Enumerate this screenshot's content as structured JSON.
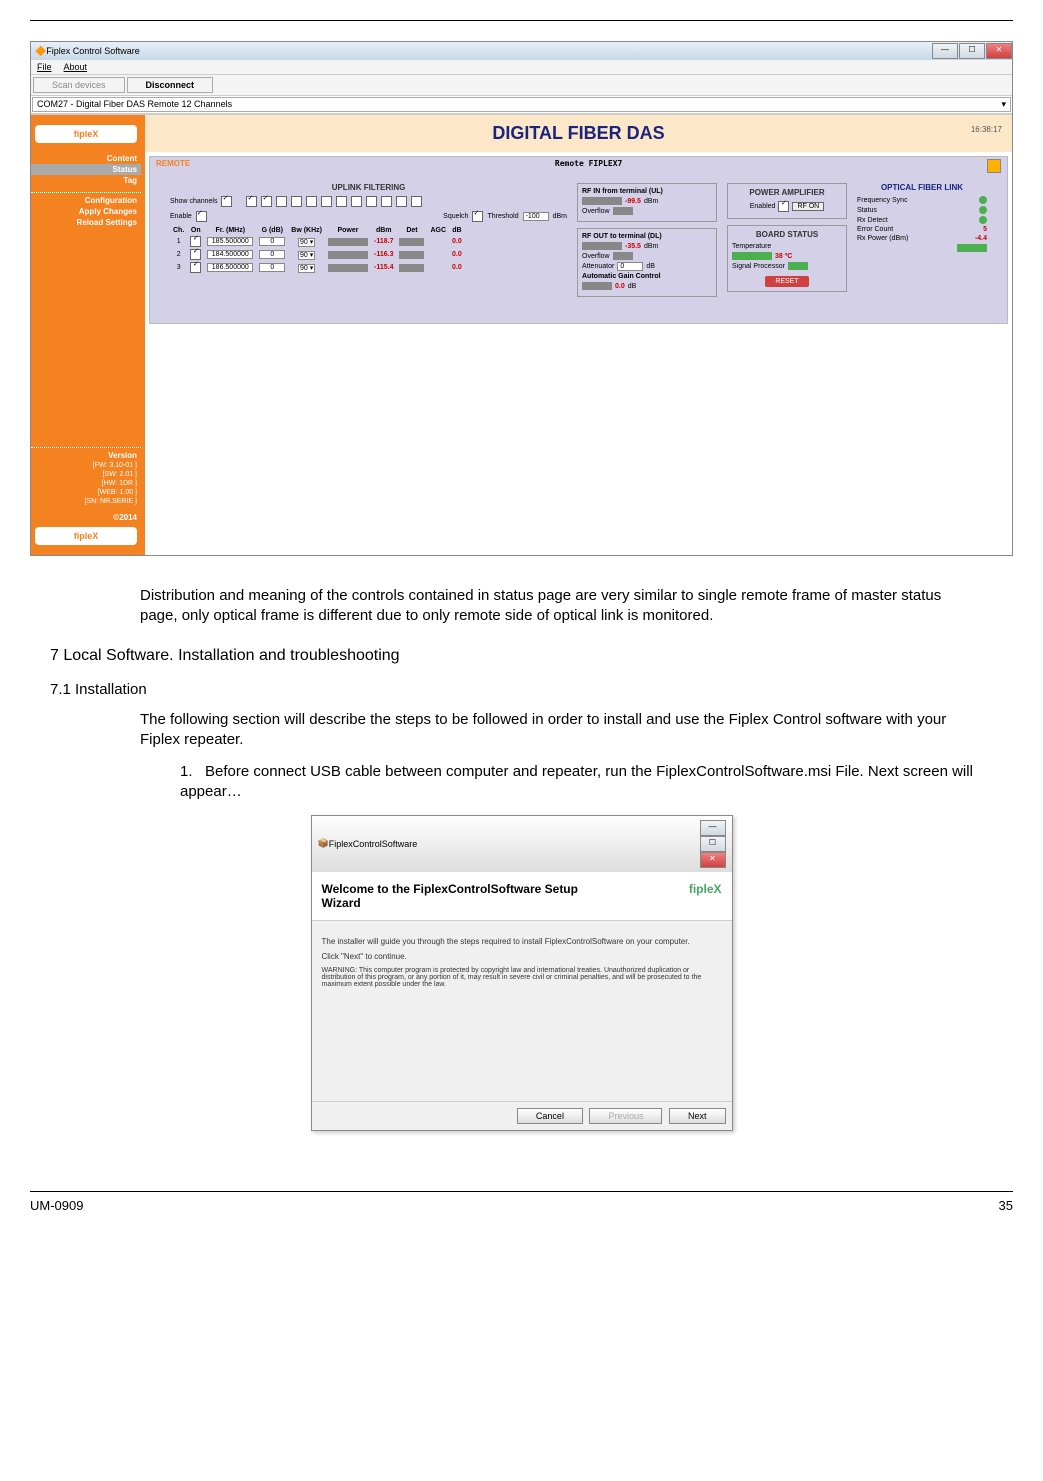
{
  "app": {
    "title": "Fiplex Control Software",
    "menu": {
      "file": "File",
      "about": "About"
    },
    "toolbar": {
      "scan": "Scan devices",
      "disconnect": "Disconnect"
    },
    "combo": "COM27 - Digital Fiber DAS Remote 12 Channels",
    "banner": "DIGITAL FIBER DAS",
    "time": "16:38:17",
    "logo": "fipleX"
  },
  "sidebar": {
    "content": "Content",
    "status": "Status",
    "tag": "Tag",
    "configuration": "Configuration",
    "apply": "Apply Changes",
    "reload": "Reload Settings",
    "version_label": "Version",
    "versions": {
      "fw": "[FW: 3.10-01 ]",
      "sw": "[SW: 2.01 ]",
      "hw": "[HW:  1DR ]",
      "web": "[WEB: 1.00 ]",
      "sn": "[SN: NR.SERIE ]"
    },
    "copyright": "©2014"
  },
  "remote": {
    "label": "REMOTE",
    "name": "Remote FIPLEX7"
  },
  "uplink": {
    "title": "UPLINK FILTERING",
    "show_channels": "Show channels",
    "enable": "Enable",
    "squelch": "Squelch",
    "threshold": "Threshold",
    "threshold_val": "-100",
    "threshold_unit": "dBm",
    "cols": {
      "ch": "Ch.",
      "on": "On",
      "fr": "Fr. (MHz)",
      "g": "G (dB)",
      "bw": "Bw (KHz)",
      "power": "Power",
      "dbm": "dBm",
      "det": "Det",
      "agc": "AGC",
      "db": "dB"
    },
    "rows": [
      {
        "n": "1",
        "fr": "185.500000",
        "g": "0",
        "bw": "90",
        "dbm": "-118.7",
        "agc": "0.0"
      },
      {
        "n": "2",
        "fr": "184.500000",
        "g": "0",
        "bw": "90",
        "dbm": "-116.3",
        "agc": "0.0"
      },
      {
        "n": "3",
        "fr": "186.500000",
        "g": "0",
        "bw": "90",
        "dbm": "-115.4",
        "agc": "0.0"
      }
    ]
  },
  "rf": {
    "in_label": "RF IN from terminal (UL)",
    "in_val": "-99.5",
    "in_unit": "dBm",
    "overflow": "Overflow",
    "out_label": "RF OUT to terminal (DL)",
    "out_val": "-35.5",
    "out_unit": "dBm",
    "attenuator": "Attenuator",
    "att_val": "0",
    "att_unit": "dB",
    "agc_label": "Automatic Gain Control",
    "agc_val": "0.0",
    "agc_unit": "dB"
  },
  "pa": {
    "title": "POWER AMPLIFIER",
    "enabled": "Enabled",
    "rf_on": "RF ON"
  },
  "board": {
    "title": "BOARD STATUS",
    "temperature": "Temperature",
    "temp_val": "38 ºC",
    "sp": "Signal Processor",
    "reset": "RESET"
  },
  "optical": {
    "title": "OPTICAL FIBER LINK",
    "freq": "Frequency Sync",
    "status": "Status",
    "rxdet": "Rx Detect",
    "errcount": "Error Count",
    "errval": "5",
    "rxpower": "Rx Power (dBm)",
    "rxval": "-4.4"
  },
  "doc": {
    "para1": "Distribution and meaning of the controls contained in status page are very similar to single remote frame of master status page, only optical frame is different due to only remote side of optical link is monitored.",
    "h7": "7    Local Software. Installation and troubleshooting",
    "h71": "7.1 Installation",
    "para2": "The following section will describe the steps to be followed in order to install and use the Fiplex Control software with your Fiplex repeater.",
    "step1_n": "1.",
    "step1": "Before connect USB cable between computer and repeater, run the FiplexControlSoftware.msi File.  Next screen will appear…"
  },
  "installer": {
    "title": "FiplexControlSoftware",
    "welcome": "Welcome to the FiplexControlSoftware Setup Wizard",
    "logo": "fipleX",
    "line1": "The installer will guide you through the steps required to install FiplexControlSoftware on your computer.",
    "line2": "Click \"Next\" to continue.",
    "warning": "WARNING: This computer program is protected by copyright law and international treaties. Unauthorized duplication or distribution of this program, or any portion of it, may result in severe civil or criminal penalties, and will be prosecuted to the maximum extent possible under the law.",
    "cancel": "Cancel",
    "previous": "Previous",
    "next": "Next"
  },
  "footer": {
    "doc": "UM-0909",
    "page": "35"
  }
}
